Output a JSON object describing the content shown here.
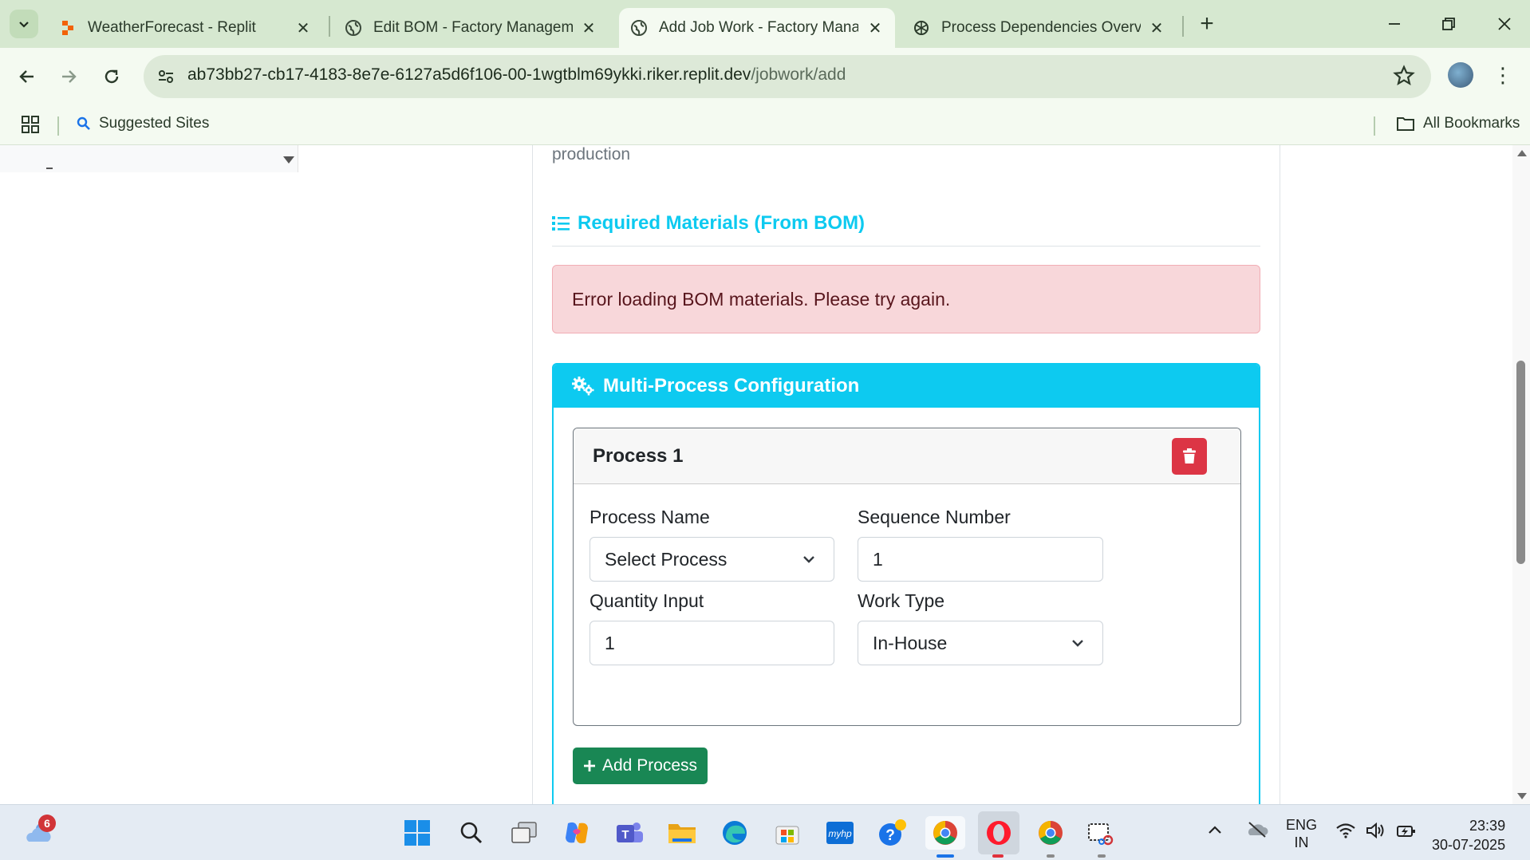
{
  "browser": {
    "tabs": [
      {
        "title": "WeatherForecast - Replit",
        "icon": "replit-icon"
      },
      {
        "title": "Edit BOM - Factory Managemer",
        "icon": "globe-icon"
      },
      {
        "title": "Add Job Work - Factory Manag",
        "icon": "globe-icon",
        "active": true
      },
      {
        "title": "Process Dependencies Overview",
        "icon": "chatgpt-icon"
      }
    ],
    "url_host": "ab73bb27-cb17-4183-8e7e-6127a5d6f106-00-1wgtblm69ykki.riker.replit.dev",
    "url_path": "/jobwork/add",
    "bookmarks": {
      "suggested": "Suggested Sites",
      "all": "All Bookmarks"
    }
  },
  "page": {
    "leftover_text": "production",
    "materials_heading": "Required Materials (From BOM)",
    "error_alert": "Error loading BOM materials. Please try again.",
    "multi_process": {
      "heading": "Multi-Process Configuration",
      "process": {
        "title": "Process 1",
        "process_name_label": "Process Name",
        "process_name_value": "Select Process",
        "sequence_label": "Sequence Number",
        "sequence_value": "1",
        "quantity_label": "Quantity Input",
        "quantity_value": "1",
        "work_type_label": "Work Type",
        "work_type_value": "In-House"
      },
      "add_button": "Add Process"
    }
  },
  "taskbar": {
    "weather_badge": "6",
    "lang_top": "ENG",
    "lang_bottom": "IN",
    "time": "23:39",
    "date": "30-07-2025"
  },
  "colors": {
    "info": "#0dcaf0",
    "danger": "#dc3545",
    "success": "#198754",
    "alert_bg": "#f8d7da",
    "chrome_bg": "#d6e8d0"
  }
}
